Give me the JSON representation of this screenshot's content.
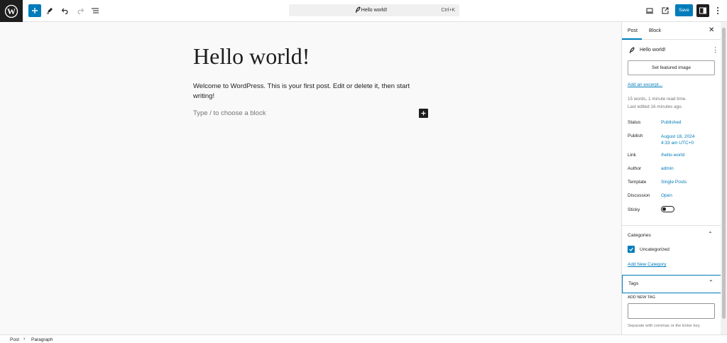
{
  "toolbar": {
    "doc_title": "Hello world!",
    "shortcut": "Ctrl+K",
    "save_label": "Save"
  },
  "editor": {
    "title": "Hello world!",
    "paragraph": "Welcome to WordPress. This is your first post. Edit or delete it, then start writing!",
    "placeholder": "Type / to choose a block"
  },
  "sidebar": {
    "tabs": [
      "Post",
      "Block"
    ],
    "post_title": "Hello world!",
    "featured_image": "Set featured image",
    "excerpt_link": "Add an excerpt...",
    "meta_line1": "15 words, 1 minute read time.",
    "meta_line2": "Last edited 16 minutes ago.",
    "properties": {
      "status": {
        "label": "Status",
        "value": "Published"
      },
      "publish": {
        "label": "Publish",
        "value_line1": "August 18, 2024",
        "value_line2": "4:33 am UTC+0"
      },
      "link": {
        "label": "Link",
        "value": "/hello-world"
      },
      "author": {
        "label": "Author",
        "value": "admin"
      },
      "template": {
        "label": "Template",
        "value": "Single Posts"
      },
      "discussion": {
        "label": "Discussion",
        "value": "Open"
      },
      "sticky": {
        "label": "Sticky",
        "checked": false
      }
    },
    "categories": {
      "title": "Categories",
      "items": [
        {
          "label": "Uncategorized",
          "checked": true
        }
      ],
      "add_new": "Add New Category"
    },
    "tags": {
      "title": "Tags",
      "field_label": "ADD NEW TAG",
      "input_value": "",
      "help": "Separate with commas or the Enter key."
    }
  },
  "footer": {
    "breadcrumb": [
      "Post",
      "Paragraph"
    ]
  },
  "colors": {
    "accent": "#007cba",
    "dark": "#1e1e1e"
  }
}
